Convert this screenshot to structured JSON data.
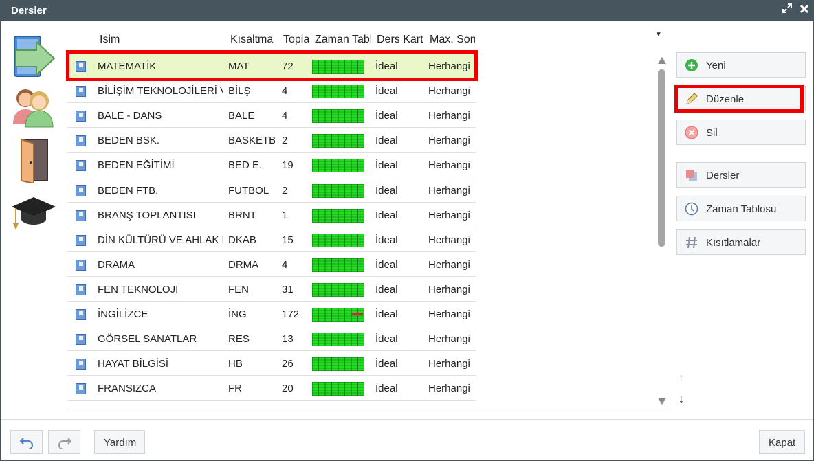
{
  "window": {
    "title": "Dersler",
    "maximize_icon": "maximize-icon",
    "close_icon": "close-icon"
  },
  "left_icons": [
    "arrow-book-icon",
    "people-icon",
    "door-icon",
    "graduation-cap-icon"
  ],
  "grid": {
    "columns": [
      "İsim",
      "Kısaltma",
      "Toplam",
      "Zaman Tablosu",
      "Ders Kartları",
      "Max. Sonraki"
    ],
    "rows": [
      {
        "name": "MATEMATİK",
        "short": "MAT",
        "total": "72",
        "cards": "İdeal",
        "max": "Herhangi",
        "red": false
      },
      {
        "name": "BİLİŞİM TEKNOLOJİLERİ VE YAZILIM",
        "short": "BİLŞ",
        "total": "4",
        "cards": "İdeal",
        "max": "Herhangi",
        "red": false
      },
      {
        "name": "BALE - DANS",
        "short": "BALE",
        "total": "4",
        "cards": "İdeal",
        "max": "Herhangi",
        "red": false
      },
      {
        "name": "BEDEN BSK.",
        "short": "BASKETBOL",
        "total": "2",
        "cards": "İdeal",
        "max": "Herhangi",
        "red": false
      },
      {
        "name": "BEDEN EĞİTİMİ",
        "short": "BED E.",
        "total": "19",
        "cards": "İdeal",
        "max": "Herhangi",
        "red": false
      },
      {
        "name": "BEDEN FTB.",
        "short": "FUTBOL",
        "total": "2",
        "cards": "İdeal",
        "max": "Herhangi",
        "red": false
      },
      {
        "name": "BRANŞ TOPLANTISI",
        "short": "BRNT",
        "total": "1",
        "cards": "İdeal",
        "max": "Herhangi",
        "red": false
      },
      {
        "name": "DİN KÜLTÜRÜ VE AHLAK BİLGİSİ",
        "short": "DKAB",
        "total": "15",
        "cards": "İdeal",
        "max": "Herhangi",
        "red": false
      },
      {
        "name": "DRAMA",
        "short": "DRMA",
        "total": "4",
        "cards": "İdeal",
        "max": "Herhangi",
        "red": false
      },
      {
        "name": "FEN TEKNOLOJİ",
        "short": "FEN",
        "total": "31",
        "cards": "İdeal",
        "max": "Herhangi",
        "red": false
      },
      {
        "name": "İNGİLİZCE",
        "short": "İNG",
        "total": "172",
        "cards": "İdeal",
        "max": "Herhangi",
        "red": true
      },
      {
        "name": "GÖRSEL SANATLAR",
        "short": "RES",
        "total": "13",
        "cards": "İdeal",
        "max": "Herhangi",
        "red": false
      },
      {
        "name": "HAYAT BİLGİSİ",
        "short": "HB",
        "total": "26",
        "cards": "İdeal",
        "max": "Herhangi",
        "red": false
      },
      {
        "name": "FRANSIZCA",
        "short": "FR",
        "total": "20",
        "cards": "İdeal",
        "max": "Herhangi",
        "red": false
      }
    ]
  },
  "side_buttons": {
    "new": "Yeni",
    "edit": "Düzenle",
    "delete": "Sil",
    "subjects": "Dersler",
    "timetable": "Zaman Tablosu",
    "constraints": "Kısıtlamalar"
  },
  "footer": {
    "help": "Yardım",
    "close": "Kapat"
  },
  "colors": {
    "titlebar": "#46555e",
    "grid_green": "#22dd22",
    "highlight": "#ee0000",
    "selected_row": "#eaf8c9"
  }
}
